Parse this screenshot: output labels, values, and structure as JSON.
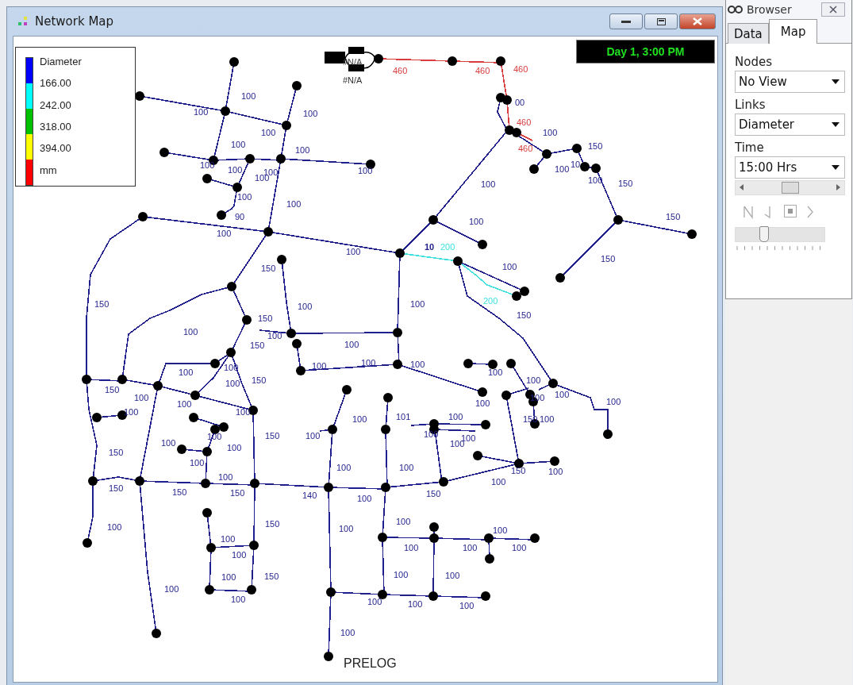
{
  "window": {
    "title": "Network Map"
  },
  "clock": "Day 1, 3:00 PM",
  "legend": {
    "title": "Diameter",
    "bands": [
      {
        "color": "#0000ff"
      },
      {
        "color": "#00ffff"
      },
      {
        "color": "#00c000"
      },
      {
        "color": "#ffff00"
      },
      {
        "color": "#ff0000"
      }
    ],
    "values": [
      "166.00",
      "242.00",
      "318.00",
      "394.00"
    ],
    "unit": "mm"
  },
  "map": {
    "links": [
      {
        "label": "00",
        "color": "#1e1e8c"
      },
      {
        "label": "460",
        "color": "#d83c3c"
      },
      {
        "label": "460",
        "color": "#d83c3c"
      },
      {
        "label": "460",
        "color": "#d83c3c"
      },
      {
        "label": "460",
        "color": "#d83c3c"
      },
      {
        "label": "460",
        "color": "#d83c3c"
      },
      {
        "label": "100",
        "color": "#1e1e8c"
      },
      {
        "label": "100",
        "color": "#1e1e8c"
      },
      {
        "label": "100",
        "color": "#1e1e8c"
      },
      {
        "label": "100",
        "color": "#1e1e8c"
      },
      {
        "label": "100",
        "color": "#1e1e8c"
      },
      {
        "label": "100",
        "color": "#1e1e8c"
      },
      {
        "label": "100",
        "color": "#1e1e8c"
      },
      {
        "label": "100",
        "color": "#1e1e8c"
      },
      {
        "label": "100",
        "color": "#1e1e8c"
      },
      {
        "label": "100",
        "color": "#1e1e8c"
      },
      {
        "label": "100",
        "color": "#1e1e8c"
      },
      {
        "label": "100",
        "color": "#1e1e8c"
      },
      {
        "label": "90",
        "color": "#1e1e8c"
      },
      {
        "label": "100",
        "color": "#1e1e8c"
      },
      {
        "label": "100",
        "color": "#1e1e8c"
      },
      {
        "label": "100",
        "color": "#1e1e8c"
      },
      {
        "label": "100",
        "color": "#1e1e8c"
      },
      {
        "label": "100",
        "color": "#1e1e8c"
      },
      {
        "label": "200",
        "color": "#3ee0e0"
      },
      {
        "label": "10",
        "color": "#1e1e8c"
      },
      {
        "label": "100",
        "color": "#1e1e8c"
      },
      {
        "label": "200",
        "color": "#3ee0e0"
      },
      {
        "label": "150",
        "color": "#1e1e8c"
      },
      {
        "label": "100",
        "color": "#1e1e8c"
      },
      {
        "label": "150",
        "color": "#1e1e8c"
      },
      {
        "label": "100",
        "color": "#1e1e8c"
      },
      {
        "label": "10",
        "color": "#1e1e8c"
      },
      {
        "label": "100",
        "color": "#1e1e8c"
      },
      {
        "label": "150",
        "color": "#1e1e8c"
      },
      {
        "label": "150",
        "color": "#1e1e8c"
      },
      {
        "label": "150",
        "color": "#1e1e8c"
      },
      {
        "label": "100",
        "color": "#1e1e8c"
      },
      {
        "label": "150",
        "color": "#1e1e8c"
      },
      {
        "label": "150",
        "color": "#1e1e8c"
      },
      {
        "label": "100",
        "color": "#1e1e8c"
      },
      {
        "label": "150",
        "color": "#1e1e8c"
      },
      {
        "label": "150",
        "color": "#1e1e8c"
      },
      {
        "label": "100",
        "color": "#1e1e8c"
      },
      {
        "label": "100",
        "color": "#1e1e8c"
      },
      {
        "label": "100",
        "color": "#1e1e8c"
      },
      {
        "label": "100",
        "color": "#1e1e8c"
      },
      {
        "label": "100",
        "color": "#1e1e8c"
      },
      {
        "label": "100",
        "color": "#1e1e8c"
      },
      {
        "label": "150",
        "color": "#1e1e8c"
      },
      {
        "label": "100",
        "color": "#1e1e8c"
      },
      {
        "label": "100",
        "color": "#1e1e8c"
      },
      {
        "label": "100",
        "color": "#1e1e8c"
      },
      {
        "label": "100",
        "color": "#1e1e8c"
      },
      {
        "label": "100",
        "color": "#1e1e8c"
      },
      {
        "label": "100",
        "color": "#1e1e8c"
      },
      {
        "label": "150",
        "color": "#1e1e8c"
      },
      {
        "label": "100",
        "color": "#1e1e8c"
      },
      {
        "label": "100",
        "color": "#1e1e8c"
      },
      {
        "label": "100",
        "color": "#1e1e8c"
      },
      {
        "label": "100",
        "color": "#1e1e8c"
      },
      {
        "label": "100",
        "color": "#1e1e8c"
      },
      {
        "label": "100",
        "color": "#1e1e8c"
      },
      {
        "label": "150",
        "color": "#1e1e8c"
      },
      {
        "label": "150",
        "color": "#1e1e8c"
      },
      {
        "label": "150",
        "color": "#1e1e8c"
      },
      {
        "label": "150",
        "color": "#1e1e8c"
      },
      {
        "label": "150",
        "color": "#1e1e8c"
      },
      {
        "label": "140",
        "color": "#1e1e8c"
      },
      {
        "label": "100",
        "color": "#1e1e8c"
      },
      {
        "label": "150",
        "color": "#1e1e8c"
      },
      {
        "label": "100",
        "color": "#1e1e8c"
      },
      {
        "label": "100",
        "color": "#1e1e8c"
      },
      {
        "label": "100",
        "color": "#1e1e8c"
      },
      {
        "label": "150",
        "color": "#1e1e8c"
      },
      {
        "label": "100",
        "color": "#1e1e8c"
      },
      {
        "label": "100",
        "color": "#1e1e8c"
      },
      {
        "label": "100",
        "color": "#1e1e8c"
      },
      {
        "label": "150",
        "color": "#1e1e8c"
      },
      {
        "label": "100",
        "color": "#1e1e8c"
      },
      {
        "label": "100",
        "color": "#1e1e8c"
      },
      {
        "label": "100",
        "color": "#1e1e8c"
      },
      {
        "label": "100",
        "color": "#1e1e8c"
      },
      {
        "label": "100",
        "color": "#1e1e8c"
      },
      {
        "label": "100",
        "color": "#1e1e8c"
      },
      {
        "label": "101",
        "color": "#1e1e8c"
      },
      {
        "label": "100",
        "color": "#1e1e8c"
      },
      {
        "label": "100",
        "color": "#1e1e8c"
      },
      {
        "label": "100",
        "color": "#1e1e8c"
      },
      {
        "label": "100",
        "color": "#1e1e8c"
      },
      {
        "label": "100",
        "color": "#1e1e8c"
      },
      {
        "label": "100",
        "color": "#1e1e8c"
      },
      {
        "label": "100",
        "color": "#1e1e8c"
      },
      {
        "label": "100",
        "color": "#1e1e8c"
      },
      {
        "label": "100",
        "color": "#1e1e8c"
      },
      {
        "label": "100",
        "color": "#1e1e8c"
      },
      {
        "label": "100",
        "color": "#1e1e8c"
      },
      {
        "label": "100",
        "color": "#1e1e8c"
      },
      {
        "label": "100",
        "color": "#1e1e8c"
      },
      {
        "label": "100",
        "color": "#1e1e8c"
      },
      {
        "label": "100",
        "color": "#1e1e8c"
      },
      {
        "label": "100",
        "color": "#1e1e8c"
      },
      {
        "label": "100",
        "color": "#1e1e8c"
      },
      {
        "label": "100",
        "color": "#1e1e8c"
      },
      {
        "label": "100",
        "color": "#1e1e8c"
      },
      {
        "label": "100",
        "color": "#1e1e8c"
      },
      {
        "label": "100",
        "color": "#1e1e8c"
      },
      {
        "label": "150",
        "color": "#1e1e8c"
      },
      {
        "label": "100",
        "color": "#1e1e8c"
      },
      {
        "label": "150",
        "color": "#1e1e8c"
      },
      {
        "label": "100",
        "color": "#1e1e8c"
      }
    ],
    "node_labels": [
      "#N/A",
      "#N/A"
    ],
    "caption": "PRELOG"
  },
  "browser": {
    "title": "Browser",
    "tabs": [
      {
        "label": "Data",
        "selected": false
      },
      {
        "label": "Map",
        "selected": true
      }
    ],
    "fields": [
      {
        "label": "Nodes",
        "value": "No View"
      },
      {
        "label": "Links",
        "value": "Diameter"
      },
      {
        "label": "Time",
        "value": "15:00 Hrs"
      }
    ],
    "speed_slider": {
      "level": 0.3
    }
  }
}
